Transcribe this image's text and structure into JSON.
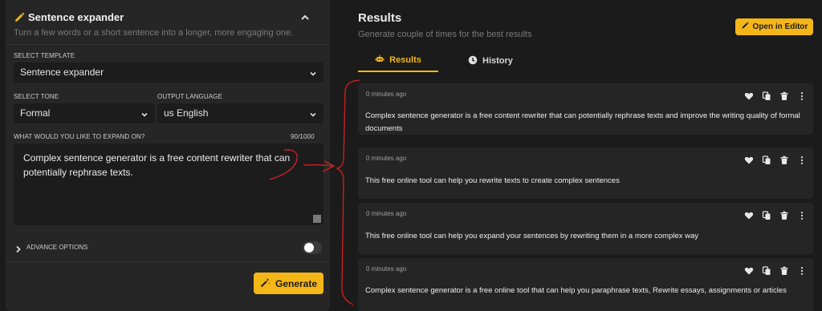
{
  "expander": {
    "title": "Sentence expander",
    "subtitle": "Turn a few words or a short sentence into a longer, more engaging one.",
    "template_label": "SELECT TEMPLATE",
    "template_value": "Sentence expander",
    "tone_label": "SELECT TONE",
    "tone_value": "Formal",
    "language_label": "OUTPUT LANGUAGE",
    "language_value": "us English",
    "input_label": "WHAT WOULD YOU LIKE TO EXPAND ON?",
    "char_count": "90/1000",
    "input_value": "Complex sentence generator is a free content rewriter that can potentially rephrase texts.",
    "advance_label": "ADVANCE OPTIONS",
    "generate_label": "Generate"
  },
  "results": {
    "title": "Results",
    "subtitle": "Generate couple of times for the best results",
    "open_editor_label": "Open in Editor",
    "tabs": [
      {
        "label": "Results",
        "active": true
      },
      {
        "label": "History",
        "active": false
      }
    ],
    "items": [
      {
        "time": "0 minutes ago",
        "text": "Complex sentence generator is a free content rewriter that can potentially rephrase texts and improve the writing quality of formal documents"
      },
      {
        "time": "0 minutes ago",
        "text": "This free online tool can help you rewrite texts to create complex sentences"
      },
      {
        "time": "0 minutes ago",
        "text": "This free online tool can help you expand your sentences by rewriting them in a more complex way"
      },
      {
        "time": "0 minutes ago",
        "text": "Complex sentence generator is a free online tool that can help you paraphrase texts, Rewrite essays, assignments or articles"
      }
    ]
  },
  "colors": {
    "accent": "#f5b617",
    "background": "#1b1b1b",
    "panel": "#262626",
    "annotation": "#d42020"
  },
  "icons": [
    "pencil-icon",
    "chevron-up-icon",
    "chevron-down-icon",
    "chevron-right-icon",
    "magic-wand-icon",
    "robot-icon",
    "clock-icon",
    "heart-icon",
    "copy-icon",
    "trash-icon",
    "more-vertical-icon"
  ]
}
